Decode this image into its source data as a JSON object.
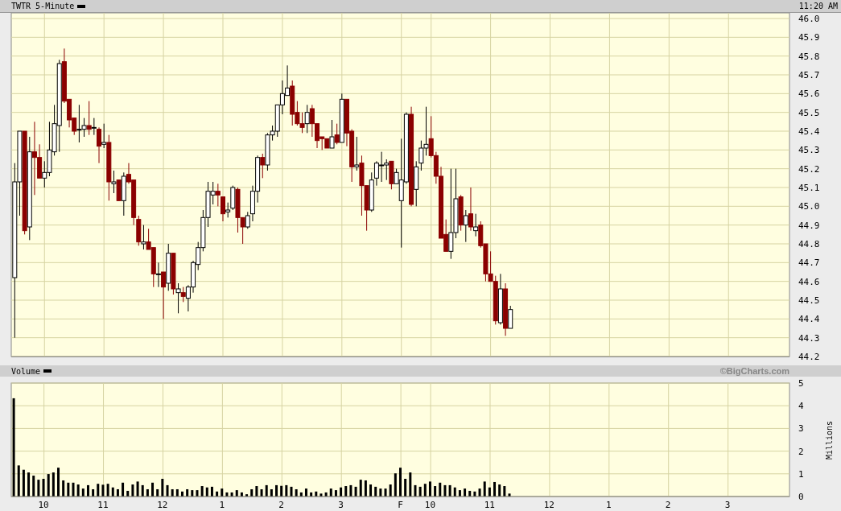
{
  "header": {
    "title": "TWTR 5-Minute",
    "time": "11:20 AM"
  },
  "price_chart": {
    "chart_data": {
      "type": "candlestick",
      "grid": true,
      "ylim": [
        44.2,
        46.0
      ],
      "categories": [
        null,
        null,
        null,
        null,
        null,
        null,
        null,
        null,
        null,
        null,
        null,
        null,
        null,
        null,
        null,
        null,
        null,
        null,
        null,
        null,
        null,
        null,
        null,
        null,
        null,
        null,
        null,
        null,
        null,
        null,
        null,
        null,
        null,
        null,
        null,
        null,
        null,
        null,
        null,
        null,
        null,
        null,
        null,
        null,
        null,
        null,
        null,
        null,
        null,
        null,
        null,
        null,
        null,
        null,
        null,
        null,
        null,
        null,
        null,
        null,
        null,
        null,
        null,
        null,
        null,
        null,
        null,
        null,
        null,
        null,
        null,
        null,
        null,
        null,
        null,
        null,
        null,
        null,
        null,
        null,
        null,
        null,
        null,
        null,
        null,
        null,
        null,
        null,
        null,
        null,
        null,
        null,
        null,
        null,
        null,
        null,
        null,
        null,
        null,
        null,
        null,
        null,
        null,
        null,
        null,
        null,
        null,
        null,
        null,
        null,
        null,
        null,
        null,
        null,
        null,
        null,
        null,
        null,
        null,
        null,
        null,
        null,
        null,
        null,
        null,
        null,
        null,
        null,
        null,
        null,
        null,
        null,
        null,
        null,
        null,
        null,
        null,
        null,
        null,
        null,
        null,
        null,
        null,
        null,
        null,
        null,
        null,
        null,
        null,
        null,
        null,
        null,
        null,
        null,
        null,
        null,
        null
      ],
      "yticks": [
        {
          "value": 44.2,
          "label": "44.2"
        },
        {
          "value": 44.3,
          "label": "44.3"
        },
        {
          "value": 44.4,
          "label": "44.4"
        },
        {
          "value": 44.5,
          "label": "44.5"
        },
        {
          "value": 44.6,
          "label": "44.6"
        },
        {
          "value": 44.7,
          "label": "44.7"
        },
        {
          "value": 44.8,
          "label": "44.8"
        },
        {
          "value": 44.9,
          "label": "44.9"
        },
        {
          "value": 45.0,
          "label": "45.0"
        },
        {
          "value": 45.1,
          "label": "45.1"
        },
        {
          "value": 45.2,
          "label": "45.2"
        },
        {
          "value": 45.3,
          "label": "45.3"
        },
        {
          "value": 45.4,
          "label": "45.4"
        },
        {
          "value": 45.5,
          "label": "45.5"
        },
        {
          "value": 45.6,
          "label": "45.6"
        },
        {
          "value": 45.7,
          "label": "45.7"
        },
        {
          "value": 45.8,
          "label": "45.8"
        },
        {
          "value": 45.9,
          "label": "45.9"
        },
        {
          "value": 46.0,
          "label": "46.0"
        }
      ],
      "ohlc": [
        [
          44.62,
          45.23,
          44.3,
          45.13
        ],
        [
          45.13,
          45.4,
          44.95,
          45.4
        ],
        [
          45.4,
          45.4,
          44.85,
          44.87
        ],
        [
          44.89,
          45.37,
          44.82,
          45.29
        ],
        [
          45.29,
          45.45,
          45.06,
          45.26
        ],
        [
          45.26,
          45.33,
          45.15,
          45.15
        ],
        [
          45.15,
          45.24,
          45.1,
          45.18
        ],
        [
          45.18,
          45.45,
          45.16,
          45.3
        ],
        [
          45.29,
          45.54,
          45.27,
          45.44
        ],
        [
          45.43,
          45.78,
          45.29,
          45.76
        ],
        [
          45.77,
          45.84,
          45.55,
          45.56
        ],
        [
          45.57,
          45.57,
          45.42,
          45.46
        ],
        [
          45.47,
          45.47,
          45.38,
          45.4
        ],
        [
          45.41,
          45.54,
          45.34,
          45.41
        ],
        [
          45.41,
          45.47,
          45.37,
          45.43
        ],
        [
          45.43,
          45.56,
          45.38,
          45.41
        ],
        [
          45.42,
          45.47,
          45.38,
          45.42
        ],
        [
          45.41,
          45.42,
          45.23,
          45.32
        ],
        [
          45.33,
          45.44,
          45.31,
          45.34
        ],
        [
          45.34,
          45.38,
          45.03,
          45.13
        ],
        [
          45.12,
          45.19,
          45.07,
          45.13
        ],
        [
          45.14,
          45.14,
          45.03,
          45.03
        ],
        [
          45.03,
          45.18,
          44.95,
          45.16
        ],
        [
          45.17,
          45.23,
          45.12,
          45.13
        ],
        [
          45.14,
          45.14,
          44.9,
          44.94
        ],
        [
          44.93,
          44.95,
          44.79,
          44.81
        ],
        [
          44.8,
          44.9,
          44.77,
          44.81
        ],
        [
          44.81,
          44.88,
          44.77,
          44.77
        ],
        [
          44.78,
          44.78,
          44.57,
          44.64
        ],
        [
          44.64,
          44.7,
          44.57,
          44.64
        ],
        [
          44.65,
          44.65,
          44.4,
          44.57
        ],
        [
          44.59,
          44.8,
          44.55,
          44.75
        ],
        [
          44.75,
          44.75,
          44.53,
          44.56
        ],
        [
          44.54,
          44.59,
          44.43,
          44.56
        ],
        [
          44.54,
          44.57,
          44.49,
          44.52
        ],
        [
          44.51,
          44.58,
          44.44,
          44.57
        ],
        [
          44.57,
          44.71,
          44.54,
          44.7
        ],
        [
          44.69,
          44.81,
          44.66,
          44.78
        ],
        [
          44.78,
          44.98,
          44.76,
          44.94
        ],
        [
          44.94,
          45.13,
          44.89,
          45.08
        ],
        [
          45.06,
          45.13,
          45.01,
          45.08
        ],
        [
          45.08,
          45.12,
          45.0,
          45.06
        ],
        [
          45.05,
          45.05,
          44.92,
          44.96
        ],
        [
          44.97,
          45.02,
          44.94,
          44.98
        ],
        [
          44.99,
          45.11,
          44.98,
          45.1
        ],
        [
          45.09,
          45.1,
          44.86,
          44.94
        ],
        [
          44.94,
          44.94,
          44.8,
          44.89
        ],
        [
          44.89,
          44.97,
          44.88,
          44.95
        ],
        [
          44.96,
          45.11,
          44.92,
          45.08
        ],
        [
          45.08,
          45.27,
          45.02,
          45.26
        ],
        [
          45.26,
          45.28,
          45.15,
          45.22
        ],
        [
          45.22,
          45.39,
          45.19,
          45.38
        ],
        [
          45.38,
          45.43,
          45.35,
          45.4
        ],
        [
          45.4,
          45.54,
          45.37,
          45.54
        ],
        [
          45.54,
          45.67,
          45.49,
          45.6
        ],
        [
          45.59,
          45.75,
          45.59,
          45.63
        ],
        [
          45.64,
          45.67,
          45.43,
          45.49
        ],
        [
          45.5,
          45.56,
          45.43,
          45.44
        ],
        [
          45.44,
          45.5,
          45.39,
          45.42
        ],
        [
          45.44,
          45.54,
          45.39,
          45.5
        ],
        [
          45.52,
          45.54,
          45.37,
          45.44
        ],
        [
          45.44,
          45.44,
          45.31,
          45.35
        ],
        [
          45.37,
          45.37,
          45.3,
          45.36
        ],
        [
          45.36,
          45.36,
          45.31,
          45.31
        ],
        [
          45.31,
          45.46,
          45.31,
          45.37
        ],
        [
          45.38,
          45.44,
          45.33,
          45.34
        ],
        [
          45.34,
          45.6,
          45.34,
          45.57
        ],
        [
          45.57,
          45.57,
          45.32,
          45.39
        ],
        [
          45.4,
          45.41,
          45.13,
          45.21
        ],
        [
          45.21,
          45.37,
          45.19,
          45.22
        ],
        [
          45.23,
          45.27,
          44.95,
          45.11
        ],
        [
          45.11,
          45.11,
          44.87,
          44.98
        ],
        [
          44.98,
          45.18,
          44.97,
          45.14
        ],
        [
          45.15,
          45.24,
          45.11,
          45.23
        ],
        [
          45.22,
          45.29,
          45.13,
          45.22
        ],
        [
          45.22,
          45.25,
          45.14,
          45.23
        ],
        [
          45.24,
          45.24,
          45.09,
          45.12
        ],
        [
          45.12,
          45.2,
          45.12,
          45.18
        ],
        [
          45.03,
          45.36,
          44.78,
          45.14
        ],
        [
          45.13,
          45.5,
          45.12,
          45.49
        ],
        [
          45.49,
          45.53,
          45.0,
          45.01
        ],
        [
          45.09,
          45.24,
          45.0,
          45.21
        ],
        [
          45.23,
          45.35,
          45.19,
          45.31
        ],
        [
          45.31,
          45.53,
          45.27,
          45.33
        ],
        [
          45.36,
          45.48,
          45.26,
          45.27
        ],
        [
          45.27,
          45.29,
          45.12,
          45.16
        ],
        [
          45.16,
          45.21,
          44.83,
          44.83
        ],
        [
          44.85,
          44.93,
          44.76,
          44.76
        ],
        [
          44.76,
          45.2,
          44.72,
          44.86
        ],
        [
          44.86,
          45.2,
          44.83,
          45.04
        ],
        [
          45.05,
          45.06,
          44.87,
          44.9
        ],
        [
          44.9,
          44.98,
          44.81,
          44.95
        ],
        [
          44.96,
          45.1,
          44.87,
          44.89
        ],
        [
          44.87,
          44.96,
          44.84,
          44.89
        ],
        [
          44.9,
          44.92,
          44.78,
          44.79
        ],
        [
          44.8,
          44.8,
          44.6,
          44.64
        ],
        [
          44.64,
          44.76,
          44.6,
          44.6
        ],
        [
          44.6,
          44.63,
          44.37,
          44.39
        ],
        [
          44.38,
          44.64,
          44.37,
          44.56
        ],
        [
          44.56,
          44.59,
          44.31,
          44.35
        ],
        [
          44.35,
          44.47,
          44.35,
          44.45
        ],
        null,
        null,
        null,
        null,
        null,
        null,
        null,
        null,
        null,
        null,
        null,
        null,
        null,
        null,
        null,
        null,
        null,
        null,
        null,
        null,
        null,
        null,
        null,
        null,
        null,
        null,
        null,
        null,
        null,
        null,
        null,
        null,
        null,
        null,
        null,
        null,
        null,
        null,
        null,
        null,
        null,
        null,
        null,
        null,
        null,
        null,
        null,
        null,
        null,
        null,
        null,
        null,
        null,
        null,
        null,
        null
      ]
    }
  },
  "volume_panel": {
    "title": "Volume",
    "credit": "©BigCharts.com"
  },
  "volume_chart": {
    "chart_data": {
      "type": "bar",
      "grid": true,
      "ylabel": "Millions",
      "ylim": [
        0,
        5
      ],
      "yticks": [
        0,
        1,
        2,
        3,
        4,
        5
      ],
      "categories": [
        null,
        null,
        null,
        null,
        null,
        null,
        "10",
        null,
        null,
        null,
        null,
        null,
        null,
        null,
        null,
        null,
        null,
        null,
        "11",
        null,
        null,
        null,
        null,
        null,
        null,
        null,
        null,
        null,
        null,
        null,
        "12",
        null,
        null,
        null,
        null,
        null,
        null,
        null,
        null,
        null,
        null,
        null,
        "1",
        null,
        null,
        null,
        null,
        null,
        null,
        null,
        null,
        null,
        null,
        null,
        "2",
        null,
        null,
        null,
        null,
        null,
        null,
        null,
        null,
        null,
        null,
        null,
        "3",
        null,
        null,
        null,
        null,
        null,
        null,
        null,
        null,
        null,
        null,
        null,
        "F",
        null,
        null,
        null,
        null,
        null,
        "10",
        null,
        null,
        null,
        null,
        null,
        null,
        null,
        null,
        null,
        null,
        null,
        "11",
        null,
        null,
        null,
        null,
        null,
        null,
        null,
        null,
        null,
        null,
        null,
        "12",
        null,
        null,
        null,
        null,
        null,
        null,
        null,
        null,
        null,
        null,
        null,
        "1",
        null,
        null,
        null,
        null,
        null,
        null,
        null,
        null,
        null,
        null,
        null,
        "2",
        null,
        null,
        null,
        null,
        null,
        null,
        null,
        null,
        null,
        null,
        null,
        "3",
        null,
        null,
        null,
        null,
        null,
        null,
        null,
        null,
        null,
        null,
        null,
        null
      ],
      "values": [
        4.33,
        1.37,
        1.18,
        1.06,
        0.92,
        0.74,
        0.78,
        0.99,
        1.06,
        1.27,
        0.71,
        0.61,
        0.61,
        0.53,
        0.35,
        0.5,
        0.32,
        0.56,
        0.52,
        0.56,
        0.4,
        0.32,
        0.61,
        0.25,
        0.53,
        0.66,
        0.5,
        0.32,
        0.61,
        0.32,
        0.78,
        0.5,
        0.32,
        0.32,
        0.22,
        0.32,
        0.28,
        0.28,
        0.46,
        0.4,
        0.43,
        0.22,
        0.35,
        0.18,
        0.18,
        0.28,
        0.18,
        0.1,
        0.32,
        0.46,
        0.32,
        0.5,
        0.32,
        0.5,
        0.47,
        0.5,
        0.43,
        0.32,
        0.18,
        0.35,
        0.18,
        0.22,
        0.13,
        0.18,
        0.35,
        0.28,
        0.4,
        0.46,
        0.5,
        0.43,
        0.74,
        0.71,
        0.53,
        0.43,
        0.35,
        0.35,
        0.53,
        1.02,
        1.27,
        0.78,
        1.06,
        0.5,
        0.43,
        0.56,
        0.66,
        0.46,
        0.61,
        0.5,
        0.5,
        0.4,
        0.28,
        0.35,
        0.25,
        0.22,
        0.35,
        0.66,
        0.4,
        0.64,
        0.53,
        0.46,
        0.13,
        null,
        null,
        null,
        null,
        null,
        null,
        null,
        null,
        null,
        null,
        null,
        null,
        null,
        null,
        null,
        null,
        null,
        null,
        null,
        null,
        null,
        null,
        null,
        null,
        null,
        null,
        null,
        null,
        null,
        null,
        null,
        null,
        null,
        null,
        null,
        null,
        null,
        null,
        null,
        null,
        null,
        null,
        null,
        null,
        null,
        null,
        null,
        null,
        null,
        null,
        null,
        null,
        null,
        null,
        null,
        null
      ]
    }
  }
}
